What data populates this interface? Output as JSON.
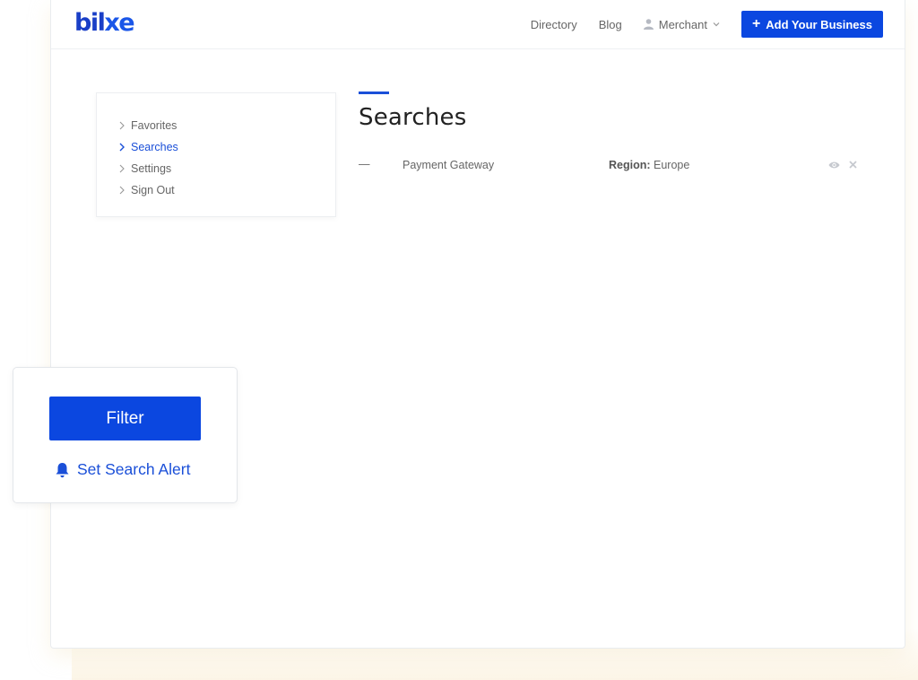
{
  "header": {
    "logo_main": "bil",
    "logo_accent": "xe",
    "nav": {
      "directory": "Directory",
      "blog": "Blog",
      "merchant": "Merchant",
      "add_business": "Add Your Business"
    }
  },
  "sidebar": {
    "items": [
      {
        "label": "Favorites"
      },
      {
        "label": "Searches"
      },
      {
        "label": "Settings"
      },
      {
        "label": "Sign Out"
      }
    ],
    "active": "Searches"
  },
  "main": {
    "title": "Searches",
    "searches": [
      {
        "dash": "—",
        "name": "Payment Gateway",
        "region_label": "Region:",
        "region_value": "Europe"
      }
    ]
  },
  "float_panel": {
    "filter_label": "Filter",
    "alert_label": "Set Search Alert"
  },
  "colors": {
    "accent": "#0b47e0",
    "link": "#1a4fd8"
  },
  "icons": [
    "user-icon",
    "chevron-down-icon",
    "plus-icon",
    "chevron-right-icon",
    "eye-icon",
    "close-icon",
    "bell-icon"
  ]
}
